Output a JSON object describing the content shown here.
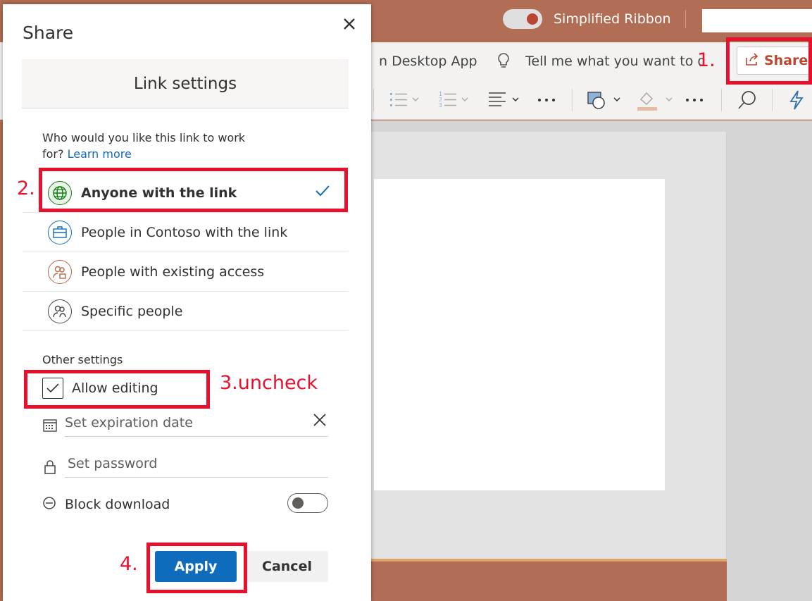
{
  "app": {
    "simplified_ribbon_label": "Simplified Ribbon",
    "open_desktop_label": "n Desktop App",
    "tell_me_placeholder": "Tell me what you want to do",
    "share_button_label": "Share"
  },
  "dialog": {
    "title": "Share",
    "section_title": "Link settings",
    "who_question": "Who would you like this link to work for?",
    "learn_more": "Learn more",
    "options": [
      {
        "label": "Anyone with the link",
        "selected": true
      },
      {
        "label": "People in Contoso with the link",
        "selected": false
      },
      {
        "label": "People with existing access",
        "selected": false
      },
      {
        "label": "Specific people",
        "selected": false
      }
    ],
    "other_settings_label": "Other settings",
    "allow_editing_label": "Allow editing",
    "allow_editing_checked": true,
    "expiration_placeholder": "Set expiration date",
    "password_placeholder": "Set password",
    "block_download_label": "Block download",
    "block_download_on": false,
    "apply_label": "Apply",
    "cancel_label": "Cancel"
  },
  "annotations": {
    "step1": "1.",
    "step2": "2.",
    "step3": "3.uncheck",
    "step4": "4."
  },
  "colors": {
    "accent_blue": "#0f6cbd",
    "brand_orange": "#b9462f",
    "annotation_red": "#e8112d"
  }
}
